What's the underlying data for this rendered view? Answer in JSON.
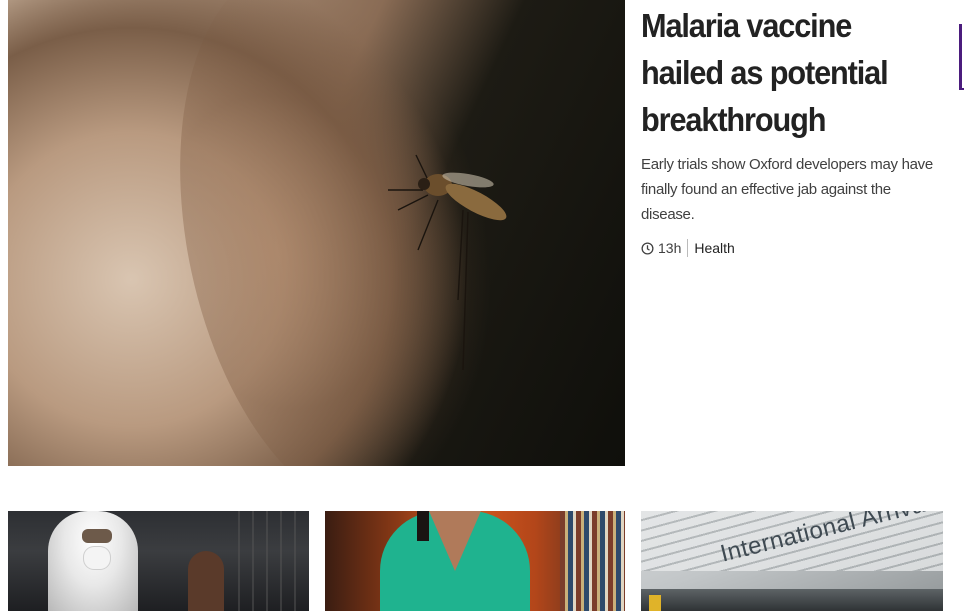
{
  "hero": {
    "image_alt": "Mosquito on human skin",
    "headline": "Malaria vaccine hailed as potential breakthrough",
    "summary": "Early trials show Oxford developers may have finally found an effective jab against the disease.",
    "time": "13h",
    "section": "Health",
    "clock_icon": "clock-icon"
  },
  "cards": [
    {
      "image_alt": "Health worker in protective suit and mask"
    },
    {
      "image_alt": "Woman in green top beside bookshelf"
    },
    {
      "image_alt": "Airport international arrivals sign",
      "sign_text": "International Arrivals"
    }
  ],
  "colors": {
    "headline": "#222222",
    "summary": "#404040",
    "accent": "#4b1c7d",
    "background": "#ffffff"
  }
}
